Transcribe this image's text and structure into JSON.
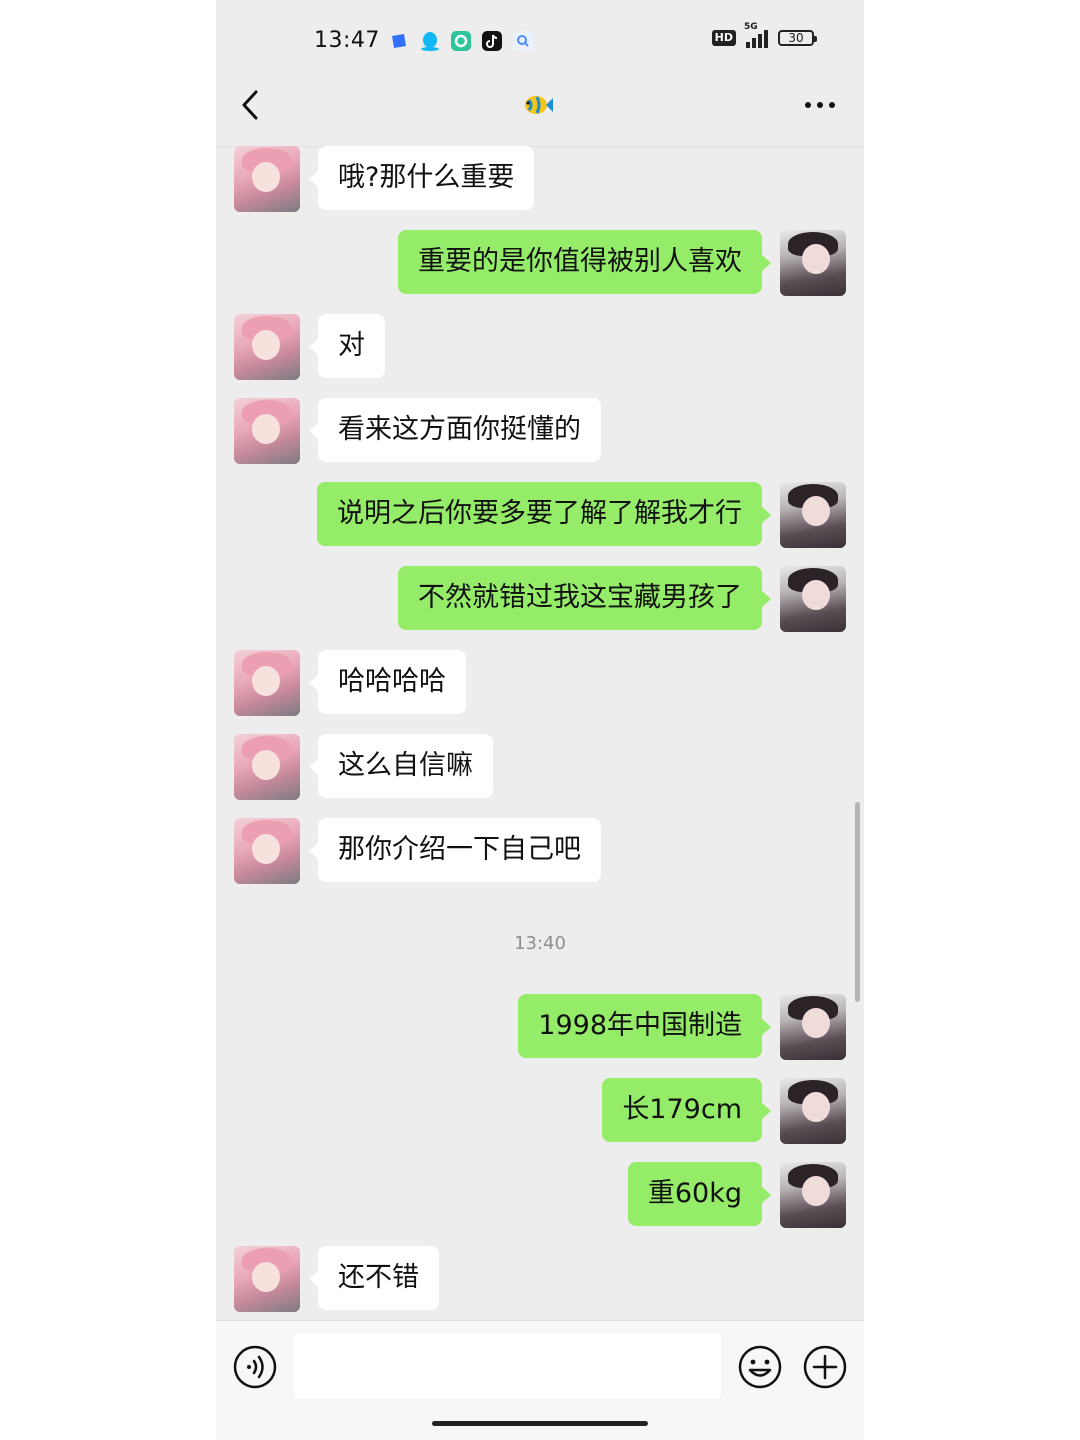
{
  "status_bar": {
    "time": "13:47",
    "hd_label": "HD",
    "network_label": "5G",
    "battery_label": "30",
    "app_icons": [
      {
        "name": "feishu-icon",
        "color": "#3370ff"
      },
      {
        "name": "qq-icon",
        "color": "#12b7f5"
      },
      {
        "name": "app-green-icon",
        "color": "#2fc59b"
      },
      {
        "name": "tiktok-icon",
        "color": "#111111"
      },
      {
        "name": "search-app-icon",
        "color": "#4e8cff"
      }
    ]
  },
  "header": {
    "back_icon": "chevron-left-icon",
    "title_icon": "fish-icon",
    "more_icon": "more-dots-icon"
  },
  "messages": [
    {
      "from": "her",
      "text": "哦?那什么重要"
    },
    {
      "from": "me",
      "text": "重要的是你值得被别人喜欢"
    },
    {
      "from": "her",
      "text": "对"
    },
    {
      "from": "her",
      "text": "看来这方面你挺懂的"
    },
    {
      "from": "me",
      "text": "说明之后你要多要了解了解我才行"
    },
    {
      "from": "me",
      "text": "不然就错过我这宝藏男孩了"
    },
    {
      "from": "her",
      "text": "哈哈哈哈"
    },
    {
      "from": "her",
      "text": "这么自信嘛"
    },
    {
      "from": "her",
      "text": "那你介绍一下自己吧"
    },
    {
      "timestamp": "13:40"
    },
    {
      "from": "me",
      "text": "1998年中国制造"
    },
    {
      "from": "me",
      "text": "长179cm"
    },
    {
      "from": "me",
      "text": "重60kg"
    },
    {
      "from": "her",
      "text": "还不错"
    }
  ],
  "input_bar": {
    "voice_icon": "voice-icon",
    "emoji_icon": "emoji-icon",
    "plus_icon": "plus-icon",
    "input_value": ""
  },
  "colors": {
    "chat_bg": "#ededed",
    "my_bubble": "#95ec69",
    "her_bubble": "#ffffff"
  }
}
